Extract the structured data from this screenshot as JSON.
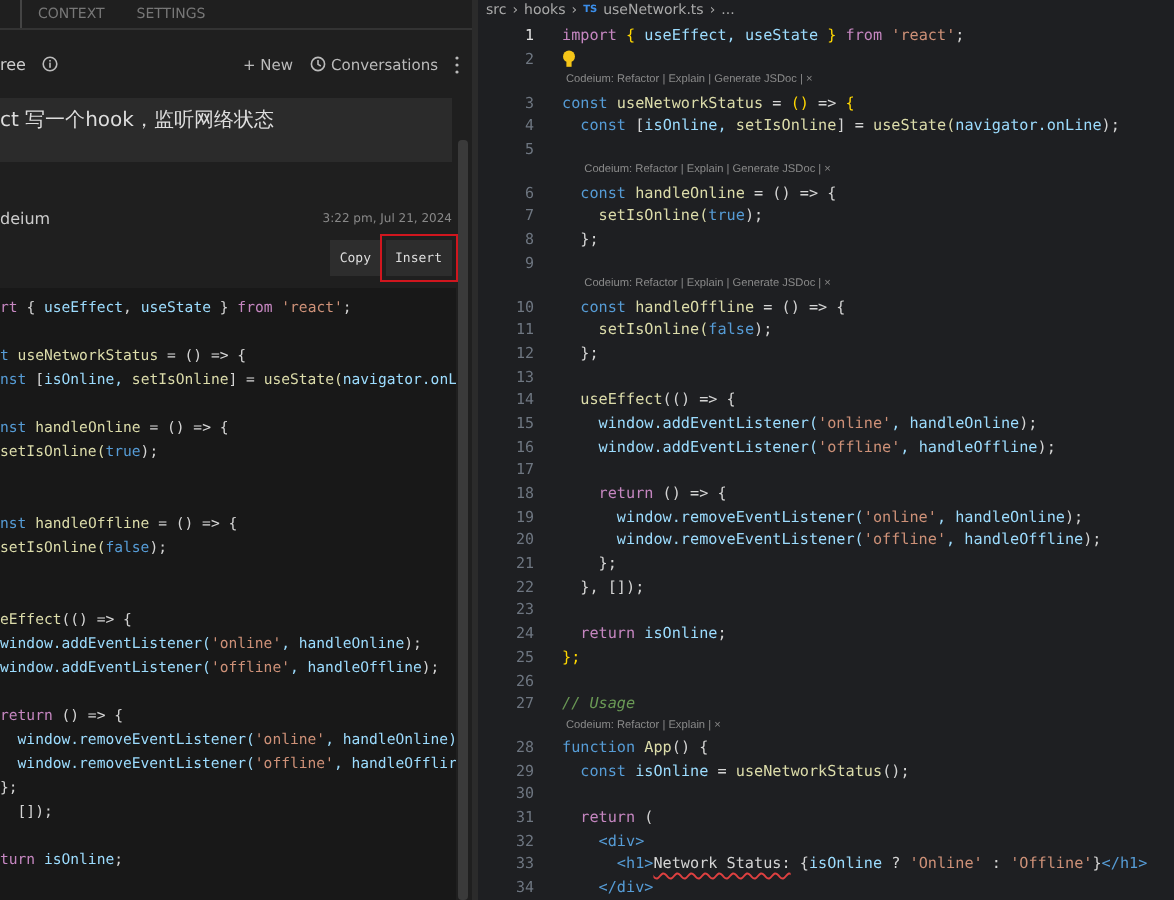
{
  "chat_panel": {
    "tabs": [
      {
        "label": "CONTEXT"
      },
      {
        "label": "SETTINGS"
      }
    ],
    "toolbar": {
      "title": "ree",
      "new_button": "+ New",
      "conversations_button": "Conversations"
    },
    "user_message": "ct 写一个hook，监听网络状态",
    "reply": {
      "author": "deium",
      "time": "3:22 pm, Jul 21, 2024",
      "buttons": [
        {
          "label": "Copy",
          "highlighted": false
        },
        {
          "label": "Insert",
          "highlighted": true
        }
      ],
      "code": [
        {
          "kind": "code",
          "tokens": [
            {
              "kind": "kw",
              "text": "rt"
            },
            {
              "kind": "pl",
              "text": " {"
            },
            {
              "kind": "var",
              "text": " useEffect"
            },
            {
              "kind": "pl",
              "text": ","
            },
            {
              "kind": "var",
              "text": " useState"
            },
            {
              "kind": "pl",
              "text": " }"
            },
            {
              "kind": "kw",
              "text": " from"
            },
            {
              "kind": "str",
              "text": " 'react'"
            },
            {
              "kind": "pl",
              "text": ";"
            }
          ]
        },
        {
          "kind": "blank"
        },
        {
          "kind": "code",
          "tokens": [
            {
              "kind": "decl",
              "text": "t"
            },
            {
              "kind": "fn",
              "text": " useNetworkStatus"
            },
            {
              "kind": "pl",
              "text": " = () => {"
            }
          ]
        },
        {
          "kind": "code",
          "tokens": [
            {
              "kind": "decl",
              "text": "nst"
            },
            {
              "kind": "pl",
              "text": " ["
            },
            {
              "kind": "var",
              "text": "isOnline,"
            },
            {
              "kind": "fn",
              "text": " setIsOnline"
            },
            {
              "kind": "pl",
              "text": "] ="
            },
            {
              "kind": "fn",
              "text": " useState("
            },
            {
              "kind": "var",
              "text": "navigator.onL"
            }
          ]
        },
        {
          "kind": "blank"
        },
        {
          "kind": "code",
          "tokens": [
            {
              "kind": "decl",
              "text": "nst"
            },
            {
              "kind": "fn",
              "text": " handleOnline"
            },
            {
              "kind": "pl",
              "text": " = () => {"
            }
          ]
        },
        {
          "kind": "code",
          "tokens": [
            {
              "kind": "fn",
              "text": "setIsOnline("
            },
            {
              "kind": "lit",
              "text": "true"
            },
            {
              "kind": "pl",
              "text": ");"
            }
          ]
        },
        {
          "kind": "blank"
        },
        {
          "kind": "blank"
        },
        {
          "kind": "code",
          "tokens": [
            {
              "kind": "decl",
              "text": "nst"
            },
            {
              "kind": "fn",
              "text": " handleOffline"
            },
            {
              "kind": "pl",
              "text": " = () => {"
            }
          ]
        },
        {
          "kind": "code",
          "tokens": [
            {
              "kind": "fn",
              "text": "setIsOnline("
            },
            {
              "kind": "lit",
              "text": "false"
            },
            {
              "kind": "pl",
              "text": ");"
            }
          ]
        },
        {
          "kind": "blank"
        },
        {
          "kind": "blank"
        },
        {
          "kind": "code",
          "tokens": [
            {
              "kind": "fn",
              "text": "eEffect"
            },
            {
              "kind": "pl",
              "text": "(() => {"
            }
          ]
        },
        {
          "kind": "code",
          "tokens": [
            {
              "kind": "var",
              "text": "window.addEventListener("
            },
            {
              "kind": "str",
              "text": "'online'"
            },
            {
              "kind": "var",
              "text": ", handleOnline"
            },
            {
              "kind": "pl",
              "text": ");"
            }
          ]
        },
        {
          "kind": "code",
          "tokens": [
            {
              "kind": "var",
              "text": "window.addEventListener("
            },
            {
              "kind": "str",
              "text": "'offline'"
            },
            {
              "kind": "var",
              "text": ", handleOffline"
            },
            {
              "kind": "pl",
              "text": ");"
            }
          ]
        },
        {
          "kind": "blank"
        },
        {
          "kind": "code",
          "tokens": [
            {
              "kind": "kw",
              "text": "return"
            },
            {
              "kind": "pl",
              "text": " () => {"
            }
          ]
        },
        {
          "kind": "code",
          "tokens": [
            {
              "kind": "var",
              "text": "  window.removeEventListener("
            },
            {
              "kind": "str",
              "text": "'online'"
            },
            {
              "kind": "var",
              "text": ", handleOnline)"
            }
          ]
        },
        {
          "kind": "code",
          "tokens": [
            {
              "kind": "var",
              "text": "  window.removeEventListener("
            },
            {
              "kind": "str",
              "text": "'offline'"
            },
            {
              "kind": "var",
              "text": ", handleOfflir"
            }
          ]
        },
        {
          "kind": "code",
          "tokens": [
            {
              "kind": "pl",
              "text": "};"
            }
          ]
        },
        {
          "kind": "code",
          "tokens": [
            {
              "kind": "pl",
              "text": "  []);"
            }
          ]
        },
        {
          "kind": "blank"
        },
        {
          "kind": "code",
          "tokens": [
            {
              "kind": "kw",
              "text": "turn"
            },
            {
              "kind": "var",
              "text": " isOnline"
            },
            {
              "kind": "pl",
              "text": ";"
            }
          ]
        }
      ]
    }
  },
  "editor": {
    "breadcrumb": [
      {
        "kind": "item",
        "text": "src"
      },
      {
        "kind": "separator",
        "text": "›"
      },
      {
        "kind": "item",
        "text": "hooks"
      },
      {
        "kind": "separator",
        "text": "›"
      },
      {
        "kind": "file",
        "icon_text": "TS",
        "text": "useNetwork.ts"
      },
      {
        "kind": "separator",
        "text": "›"
      },
      {
        "kind": "item",
        "text": "..."
      }
    ],
    "lines": [
      {
        "kind": "code",
        "number": "1",
        "current": true,
        "tokens": [
          {
            "kind": "kw",
            "text": "import"
          },
          {
            "kind": "br",
            "text": " {"
          },
          {
            "kind": "var",
            "text": " useEffect,"
          },
          {
            "kind": "var",
            "text": " useState"
          },
          {
            "kind": "br",
            "text": " }"
          },
          {
            "kind": "kw",
            "text": " from"
          },
          {
            "kind": "str",
            "text": " 'react'"
          },
          {
            "kind": "pl",
            "text": ";"
          }
        ]
      },
      {
        "kind": "hint",
        "number": "2",
        "current": false
      },
      {
        "kind": "lens",
        "text": "Codeium: Refactor | Explain | Generate JSDoc | ×"
      },
      {
        "kind": "code",
        "number": "3",
        "current": false,
        "tokens": [
          {
            "kind": "decl",
            "text": "const"
          },
          {
            "kind": "fn",
            "text": " useNetworkStatus"
          },
          {
            "kind": "pl",
            "text": " ="
          },
          {
            "kind": "br",
            "text": " ()"
          },
          {
            "kind": "pl",
            "text": " =>"
          },
          {
            "kind": "br",
            "text": " {"
          }
        ]
      },
      {
        "kind": "code",
        "number": "4",
        "current": false,
        "tokens": [
          {
            "kind": "decl",
            "text": "  const"
          },
          {
            "kind": "pl",
            "text": " ["
          },
          {
            "kind": "var",
            "text": "isOnline,"
          },
          {
            "kind": "fn",
            "text": " setIsOnline"
          },
          {
            "kind": "pl",
            "text": "] ="
          },
          {
            "kind": "fn",
            "text": " useState("
          },
          {
            "kind": "var",
            "text": "navigator.onLine"
          },
          {
            "kind": "pl",
            "text": ");"
          }
        ]
      },
      {
        "kind": "code",
        "number": "5",
        "current": false
      },
      {
        "kind": "lens",
        "text": "Codeium: Refactor | Explain | Generate JSDoc | ×"
      },
      {
        "kind": "code",
        "number": "6",
        "current": false,
        "tokens": [
          {
            "kind": "decl",
            "text": "  const"
          },
          {
            "kind": "fn",
            "text": " handleOnline"
          },
          {
            "kind": "pl",
            "text": " = () => {"
          }
        ]
      },
      {
        "kind": "code",
        "number": "7",
        "current": false,
        "tokens": [
          {
            "kind": "fn",
            "text": "    setIsOnline("
          },
          {
            "kind": "lit",
            "text": "true"
          },
          {
            "kind": "pl",
            "text": ");"
          }
        ]
      },
      {
        "kind": "code",
        "number": "8",
        "current": false,
        "tokens": [
          {
            "kind": "pl",
            "text": "  };"
          }
        ]
      },
      {
        "kind": "code",
        "number": "9",
        "current": false
      },
      {
        "kind": "lens",
        "text": "Codeium: Refactor | Explain | Generate JSDoc | ×"
      },
      {
        "kind": "code",
        "number": "10",
        "current": false,
        "tokens": [
          {
            "kind": "decl",
            "text": "  const"
          },
          {
            "kind": "fn",
            "text": " handleOffline"
          },
          {
            "kind": "pl",
            "text": " = () => {"
          }
        ]
      },
      {
        "kind": "code",
        "number": "11",
        "current": false,
        "tokens": [
          {
            "kind": "fn",
            "text": "    setIsOnline("
          },
          {
            "kind": "lit",
            "text": "false"
          },
          {
            "kind": "pl",
            "text": ");"
          }
        ]
      },
      {
        "kind": "code",
        "number": "12",
        "current": false,
        "tokens": [
          {
            "kind": "pl",
            "text": "  };"
          }
        ]
      },
      {
        "kind": "code",
        "number": "13",
        "current": false
      },
      {
        "kind": "code",
        "number": "14",
        "current": false,
        "tokens": [
          {
            "kind": "fn",
            "text": "  useEffect"
          },
          {
            "kind": "pl",
            "text": "(() => {"
          }
        ]
      },
      {
        "kind": "code",
        "number": "15",
        "current": false,
        "tokens": [
          {
            "kind": "var",
            "text": "    window.addEventListener("
          },
          {
            "kind": "str",
            "text": "'online'"
          },
          {
            "kind": "var",
            "text": ", handleOnline"
          },
          {
            "kind": "pl",
            "text": ");"
          }
        ]
      },
      {
        "kind": "code",
        "number": "16",
        "current": false,
        "tokens": [
          {
            "kind": "var",
            "text": "    window.addEventListener("
          },
          {
            "kind": "str",
            "text": "'offline'"
          },
          {
            "kind": "var",
            "text": ", handleOffline"
          },
          {
            "kind": "pl",
            "text": ");"
          }
        ]
      },
      {
        "kind": "code",
        "number": "17",
        "current": false
      },
      {
        "kind": "code",
        "number": "18",
        "current": false,
        "tokens": [
          {
            "kind": "kw",
            "text": "    return"
          },
          {
            "kind": "pl",
            "text": " () => {"
          }
        ]
      },
      {
        "kind": "code",
        "number": "19",
        "current": false,
        "tokens": [
          {
            "kind": "var",
            "text": "      window.removeEventListener("
          },
          {
            "kind": "str",
            "text": "'online'"
          },
          {
            "kind": "var",
            "text": ", handleOnline"
          },
          {
            "kind": "pl",
            "text": ");"
          }
        ]
      },
      {
        "kind": "code",
        "number": "20",
        "current": false,
        "tokens": [
          {
            "kind": "var",
            "text": "      window.removeEventListener("
          },
          {
            "kind": "str",
            "text": "'offline'"
          },
          {
            "kind": "var",
            "text": ", handleOffline"
          },
          {
            "kind": "pl",
            "text": ");"
          }
        ]
      },
      {
        "kind": "code",
        "number": "21",
        "current": false,
        "tokens": [
          {
            "kind": "pl",
            "text": "    };"
          }
        ]
      },
      {
        "kind": "code",
        "number": "22",
        "current": false,
        "tokens": [
          {
            "kind": "pl",
            "text": "  }, []);"
          }
        ]
      },
      {
        "kind": "code",
        "number": "23",
        "current": false
      },
      {
        "kind": "code",
        "number": "24",
        "current": false,
        "tokens": [
          {
            "kind": "kw",
            "text": "  return"
          },
          {
            "kind": "var",
            "text": " isOnline"
          },
          {
            "kind": "pl",
            "text": ";"
          }
        ]
      },
      {
        "kind": "code",
        "number": "25",
        "current": false,
        "tokens": [
          {
            "kind": "br",
            "text": "};"
          }
        ]
      },
      {
        "kind": "code",
        "number": "26",
        "current": false
      },
      {
        "kind": "code",
        "number": "27",
        "current": false,
        "tokens": [
          {
            "kind": "com",
            "text": "// Usage"
          }
        ]
      },
      {
        "kind": "lens",
        "text": "Codeium: Refactor | Explain | ×"
      },
      {
        "kind": "code",
        "number": "28",
        "current": false,
        "tokens": [
          {
            "kind": "decl",
            "text": "function"
          },
          {
            "kind": "fn",
            "text": " App"
          },
          {
            "kind": "pl",
            "text": "() {"
          }
        ]
      },
      {
        "kind": "code",
        "number": "29",
        "current": false,
        "tokens": [
          {
            "kind": "decl",
            "text": "  const"
          },
          {
            "kind": "var",
            "text": " isOnline"
          },
          {
            "kind": "pl",
            "text": " ="
          },
          {
            "kind": "fn",
            "text": " useNetworkStatus"
          },
          {
            "kind": "pl",
            "text": "();"
          }
        ]
      },
      {
        "kind": "code",
        "number": "30",
        "current": false
      },
      {
        "kind": "code",
        "number": "31",
        "current": false,
        "tokens": [
          {
            "kind": "kw",
            "text": "  return"
          },
          {
            "kind": "pl",
            "text": " ("
          }
        ]
      },
      {
        "kind": "code",
        "number": "32",
        "current": false,
        "tokens": [
          {
            "kind": "tag",
            "text": "    <div>"
          }
        ]
      },
      {
        "kind": "code",
        "number": "33",
        "current": false,
        "tokens": [
          {
            "kind": "tag",
            "text": "      <h1>"
          },
          {
            "kind": "err",
            "text": "Network Status:"
          },
          {
            "kind": "pl",
            "text": " {"
          },
          {
            "kind": "var",
            "text": "isOnline"
          },
          {
            "kind": "pl",
            "text": " ?"
          },
          {
            "kind": "str",
            "text": " 'Online'"
          },
          {
            "kind": "pl",
            "text": " :"
          },
          {
            "kind": "str",
            "text": " 'Offline'"
          },
          {
            "kind": "pl",
            "text": "}"
          },
          {
            "kind": "tag",
            "text": "</h1>"
          }
        ]
      },
      {
        "kind": "code",
        "number": "34",
        "current": false,
        "tokens": [
          {
            "kind": "tag",
            "text": "    </div>"
          }
        ]
      }
    ]
  }
}
